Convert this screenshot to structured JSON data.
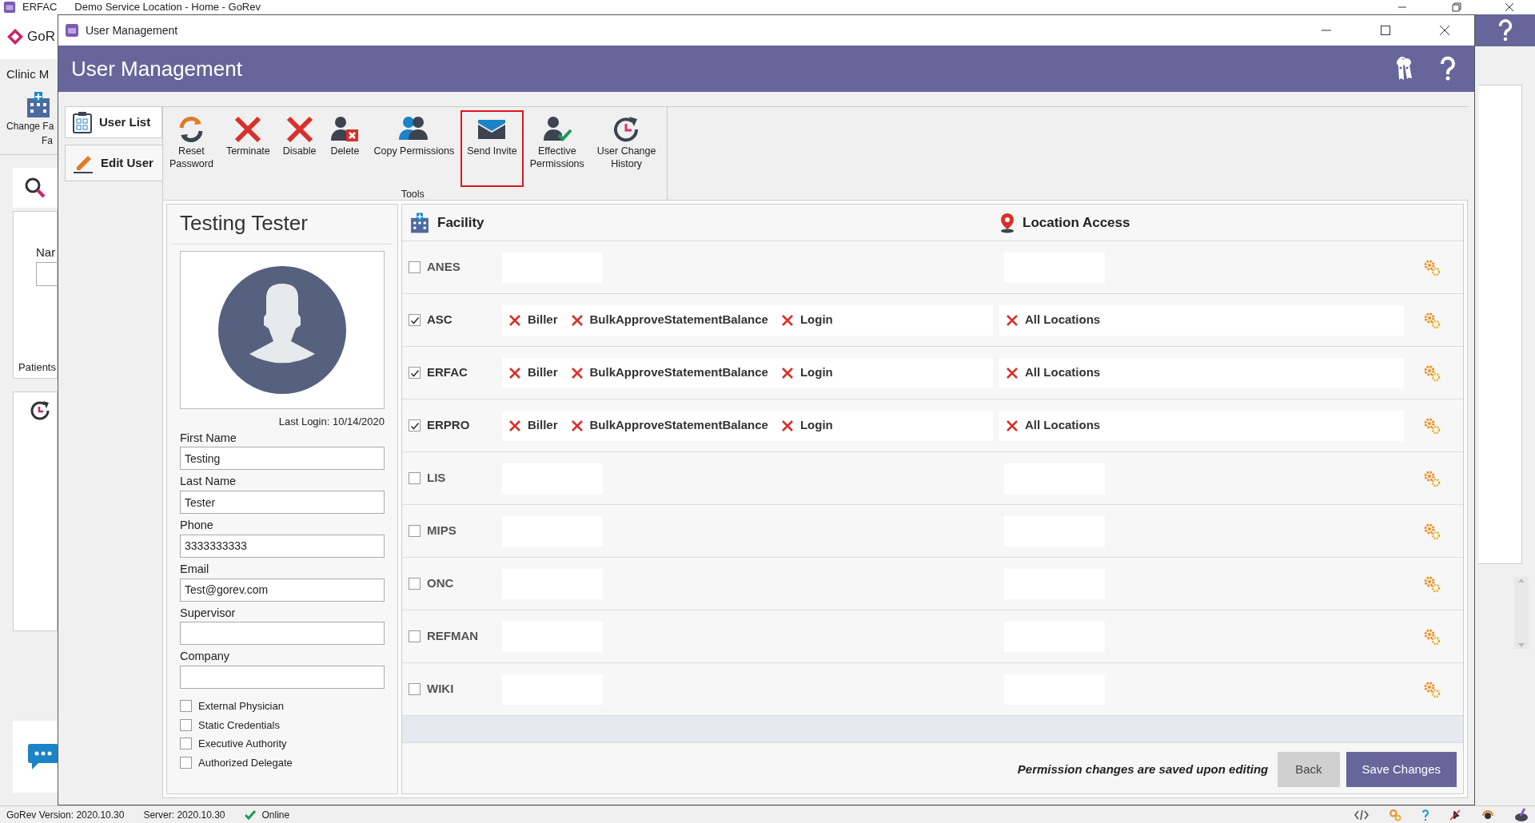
{
  "background_window": {
    "app": "ERFAC",
    "title": "Demo Service Location - Home - GoRev",
    "logo_text": "GoR",
    "ribbon_tab": "Clinic M",
    "ribbon_button": "Change Fa",
    "ribbon_group": "Fa",
    "field_label": "Nar",
    "panel_label": "Patients",
    "status_bar": {
      "version": "GoRev Version: 2020.10.30",
      "server": "Server: 2020.10.30",
      "connection": "Online"
    }
  },
  "dialog": {
    "title": "User Management",
    "header": "User Management"
  },
  "side_tabs": [
    {
      "label": "User List",
      "kind": "list",
      "selected": false
    },
    {
      "label": "Edit User",
      "kind": "edit",
      "selected": true
    }
  ],
  "toolbar": {
    "group": "Tools",
    "buttons": [
      {
        "label": "Reset\nPassword",
        "kind": "refresh",
        "highlighted": false
      },
      {
        "label": "Terminate",
        "kind": "cross",
        "highlighted": false
      },
      {
        "label": "Disable",
        "kind": "cross",
        "highlighted": false
      },
      {
        "label": "Delete",
        "kind": "user-remove",
        "highlighted": false
      },
      {
        "label": "Copy Permissions",
        "kind": "users",
        "highlighted": false
      },
      {
        "label": "Send Invite",
        "kind": "envelope",
        "highlighted": true
      },
      {
        "label": "Effective\nPermissions",
        "kind": "user-check",
        "highlighted": false
      },
      {
        "label": "User Change\nHistory",
        "kind": "history",
        "highlighted": false
      }
    ]
  },
  "user": {
    "name": "Testing Tester",
    "last_login": "Last Login: 10/14/2020",
    "fields": [
      {
        "label": "First Name",
        "value": "Testing"
      },
      {
        "label": "Last Name",
        "value": "Tester"
      },
      {
        "label": "Phone",
        "value": "3333333333"
      },
      {
        "label": "Email",
        "value": "Test@gorev.com"
      },
      {
        "label": "Supervisor"
      },
      {
        "label": "Company"
      }
    ],
    "options": [
      {
        "label": "External Physician",
        "checked": false
      },
      {
        "label": "Static Credentials",
        "checked": false
      },
      {
        "label": "Executive Authority",
        "checked": false
      },
      {
        "label": "Authorized Delegate",
        "checked": false
      }
    ]
  },
  "permissions": {
    "facility_header": "Facility",
    "location_header": "Location Access",
    "rows": [
      {
        "facility": "ANES",
        "checked": false
      },
      {
        "facility": "ASC",
        "checked": true,
        "roles": [
          "Biller",
          "BulkApproveStatementBalance",
          "Login"
        ],
        "locations": [
          "All Locations"
        ]
      },
      {
        "facility": "ERFAC",
        "checked": true,
        "roles": [
          "Biller",
          "BulkApproveStatementBalance",
          "Login"
        ],
        "locations": [
          "All Locations"
        ]
      },
      {
        "facility": "ERPRO",
        "checked": true,
        "roles": [
          "Biller",
          "BulkApproveStatementBalance",
          "Login"
        ],
        "locations": [
          "All Locations"
        ]
      },
      {
        "facility": "LIS",
        "checked": false
      },
      {
        "facility": "MIPS",
        "checked": false
      },
      {
        "facility": "ONC",
        "checked": false
      },
      {
        "facility": "REFMAN",
        "checked": false
      },
      {
        "facility": "WIKI",
        "checked": false
      }
    ]
  },
  "footer": {
    "note": "Permission changes are saved upon editing",
    "buttons": [
      {
        "label": "Back",
        "kind": "secondary"
      },
      {
        "label": "Save Changes",
        "kind": "primary"
      }
    ]
  }
}
